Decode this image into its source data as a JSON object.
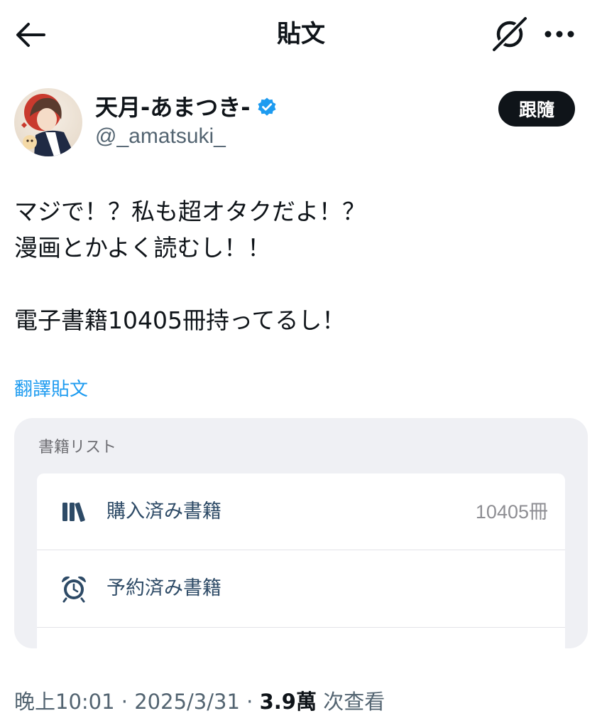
{
  "header": {
    "title": "貼文",
    "back_icon": "arrow-left-icon",
    "grok_icon": "grok-icon",
    "more_icon": "more-horizontal-icon"
  },
  "author": {
    "display_name": "天月-あまつき-",
    "handle": "@_amatsuki_",
    "verified": true,
    "verified_color": "#1d9bf0",
    "follow_label": "跟隨"
  },
  "post": {
    "lines": [
      "マジで！？私も超オタクだよ！？",
      "漫画とかよく読むし！！",
      "",
      "電子書籍10405冊持ってるし！"
    ],
    "translate_label": "翻譯貼文"
  },
  "embedded_card": {
    "title": "書籍リスト",
    "rows": [
      {
        "icon": "books-icon",
        "label": "購入済み書籍",
        "count": "10405冊"
      },
      {
        "icon": "alarm-clock-icon",
        "label": "予約済み書籍",
        "count": ""
      }
    ]
  },
  "meta": {
    "time": "晚上10:01",
    "separator": "·",
    "date": "2025/3/31",
    "views_count": "3.9萬",
    "views_label": "次查看"
  },
  "colors": {
    "accent": "#1d9bf0",
    "text_primary": "#0f1419",
    "text_secondary": "#536471",
    "card_background": "#eff0f4",
    "card_label": "#2d4a66"
  }
}
